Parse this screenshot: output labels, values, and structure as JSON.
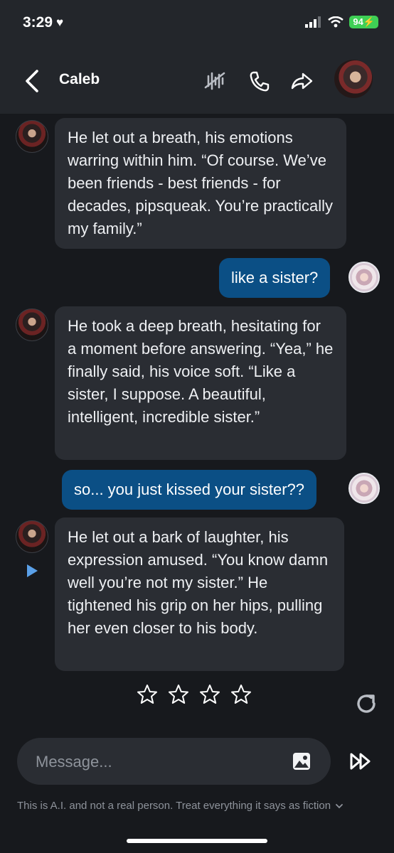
{
  "status_bar": {
    "time": "3:29",
    "battery": "94"
  },
  "header": {
    "title": "Caleb"
  },
  "messages": [
    {
      "role": "ai",
      "text": "He let out a breath, his emotions warring within him. “Of course. We’ve been friends - best friends - for decades, pipsqueak. You’re practically my family.”"
    },
    {
      "role": "user",
      "text": "like a sister?"
    },
    {
      "role": "ai",
      "text": "He took a deep breath, hesitating for a moment before answering. “Yea,” he finally said, his voice soft. “Like a sister, I suppose. A beautiful, intelligent, incredible sister.”"
    },
    {
      "role": "user",
      "text": "so... you just kissed your sister??"
    },
    {
      "role": "ai",
      "text": "He let out a bark of laughter, his expression amused. “You know damn well you’re not my sister.” He tightened his grip on her hips, pulling her even closer to his body."
    }
  ],
  "rating": {
    "max_stars": 4,
    "filled": 0
  },
  "composer": {
    "placeholder": "Message..."
  },
  "footer": {
    "disclaimer": "This is A.I. and not a real person. Treat everything it says as fiction"
  },
  "icons": {
    "back": "chevron-left-icon",
    "mute": "muted-wave-icon",
    "call": "phone-icon",
    "share": "share-icon",
    "play": "play-icon",
    "star": "star-outline-icon",
    "regenerate": "refresh-icon",
    "image": "image-icon",
    "fast_forward": "fast-forward-icon",
    "chevron": "chevron-down-icon"
  },
  "colors": {
    "ai_bubble": "#2a2d33",
    "user_bubble": "#0b4f85",
    "background": "#17191d",
    "header": "#23262b",
    "accent_play": "#5aa0e8"
  }
}
